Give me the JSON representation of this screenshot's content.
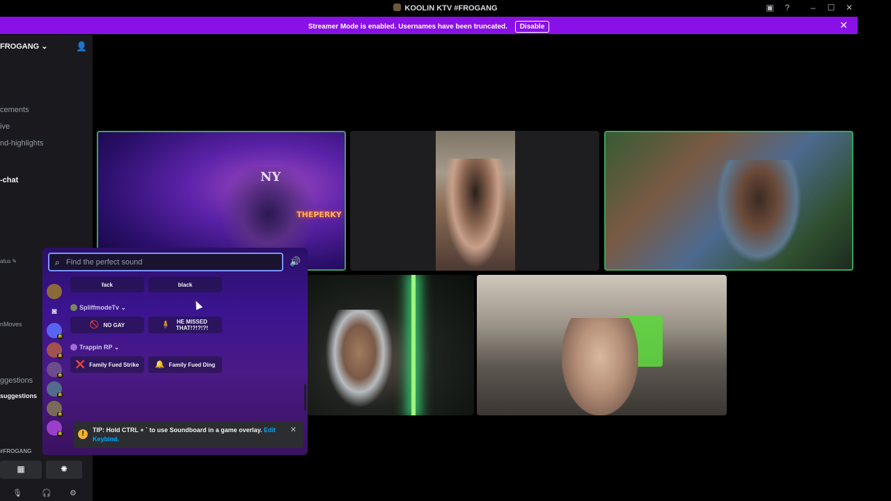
{
  "window": {
    "title": "KOOLIN KTV #FROGANG",
    "controls": {
      "minimize": "–",
      "maximize": "☐",
      "close": "✕"
    }
  },
  "banner": {
    "message": "Streamer Mode is enabled. Usernames have been truncated.",
    "disable_label": "Disable",
    "close": "✕",
    "color": "#8a10e8"
  },
  "sidebar": {
    "server_name": "FROGANG",
    "channels": [
      "cements",
      "ive",
      "nd-highlights",
      "-chat",
      "atus",
      "nMoves",
      "ggestions",
      "suggestions"
    ],
    "voice_label": "#FROGANG"
  },
  "soundboard": {
    "search_placeholder": "Find the perfect sound",
    "top_sounds": [
      "fack",
      "black"
    ],
    "categories": [
      {
        "name": "SpliffmodeTv",
        "sounds": [
          {
            "label": "NO GAY",
            "icon": "🚫"
          },
          {
            "label": "HE MISSED THAT!?!?!?!",
            "icon": "🧍"
          }
        ]
      },
      {
        "name": "Trappin RP",
        "sounds": [
          {
            "label": "Family Fued Strike",
            "icon": "❌"
          },
          {
            "label": "Family Fued Ding",
            "icon": "🔔"
          }
        ]
      }
    ],
    "tip": {
      "text": "TIP: Hold CTRL + ` to use Soundboard in a game overlay.",
      "link": "Edit Keybind."
    }
  },
  "videos": {
    "tile1_sign": "THEPERKY",
    "tile1_cap": "NY"
  },
  "colors": {
    "accent": "#8a10e8",
    "speaking": "#3ba55c",
    "search_focus": "#7c95ff",
    "link": "#00a8fc"
  }
}
